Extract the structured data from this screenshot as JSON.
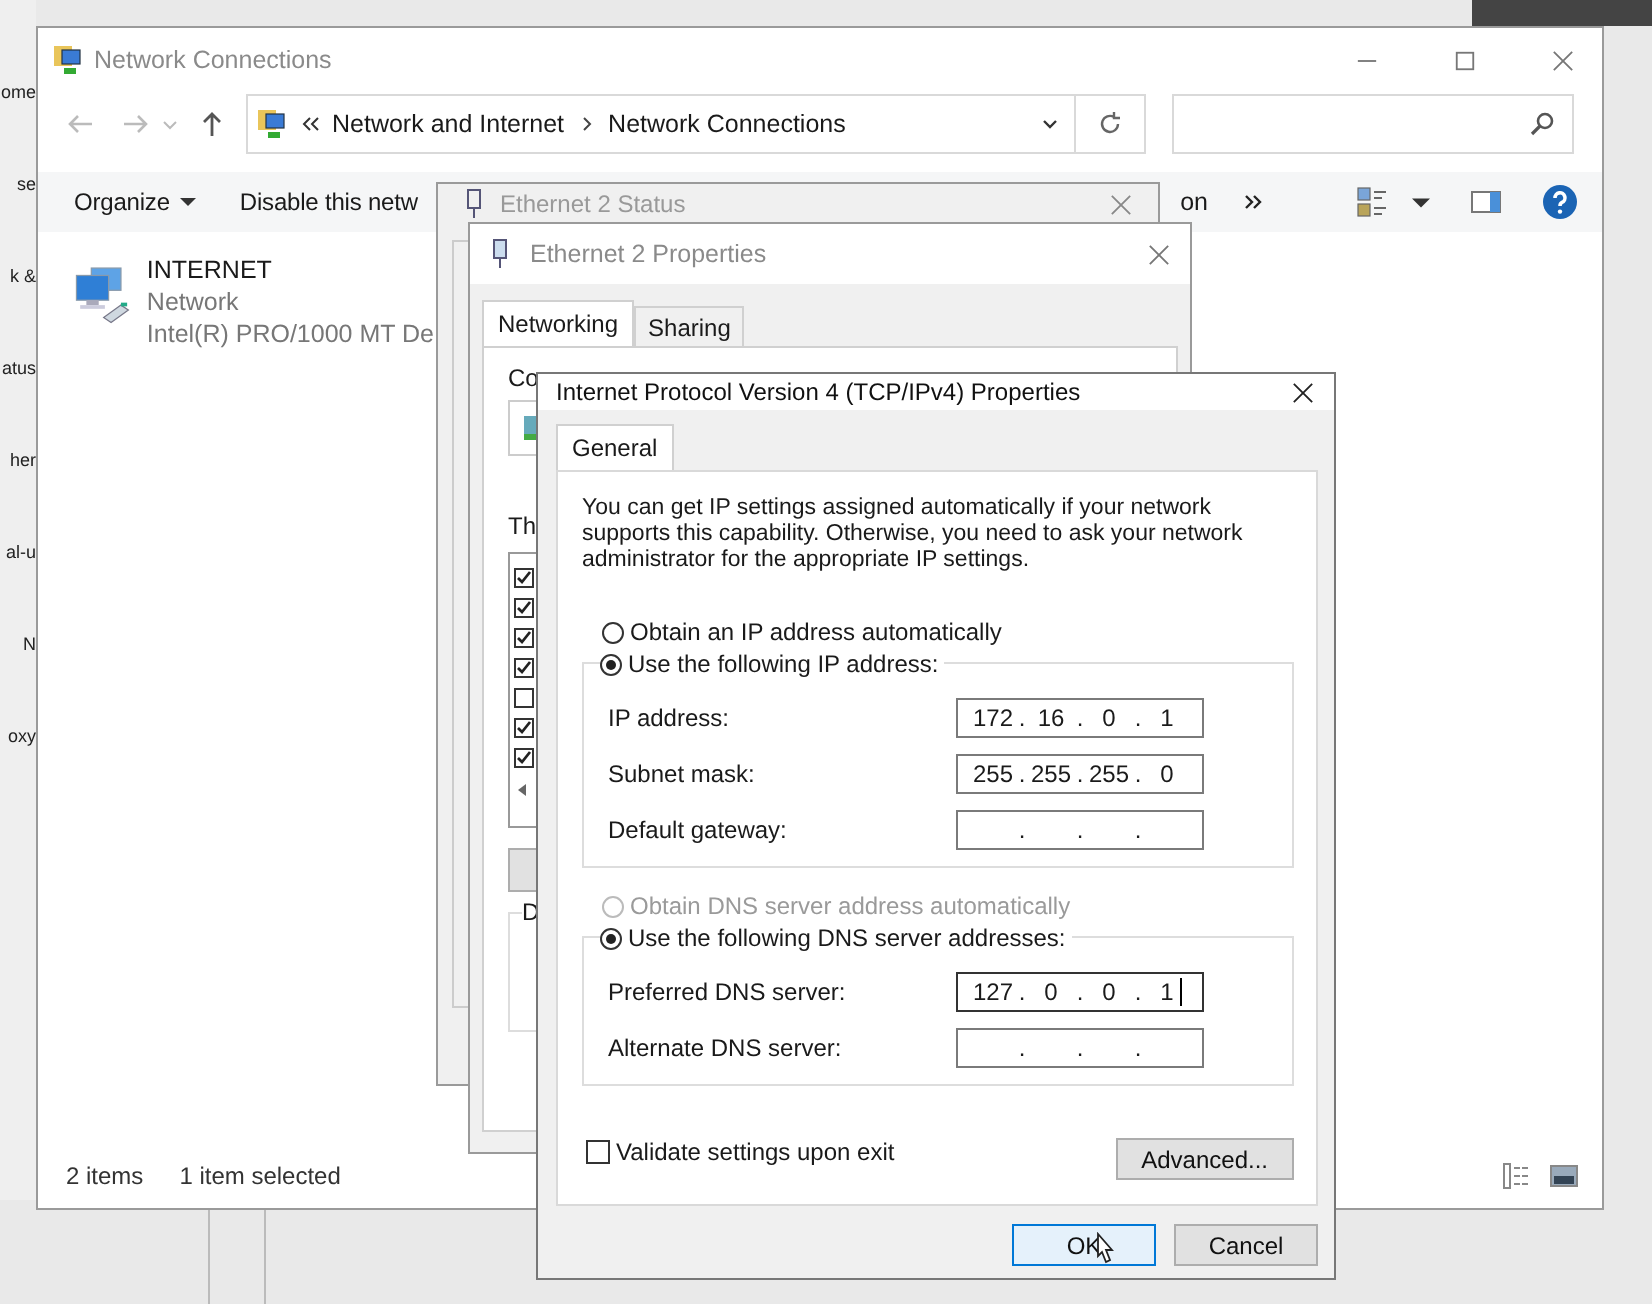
{
  "background_window": {
    "fragments": [
      "ome",
      "se",
      "k &",
      "atus",
      "her",
      "al-u",
      "N",
      "oxy"
    ]
  },
  "explorer": {
    "title": "Network Connections",
    "address": [
      "Network and Internet",
      "Network Connections"
    ],
    "toolbar": [
      {
        "label": "Organize",
        "dropdown": true
      },
      {
        "label": "Disable this netw",
        "dropdown": false
      }
    ],
    "toolbar_tail": "on",
    "items": [
      {
        "name": "INTERNET",
        "type": "Network",
        "device": "Intel(R) PRO/1000 MT De"
      }
    ],
    "status": [
      "2 items",
      "1 item selected"
    ]
  },
  "status_window": {
    "title": "Ethernet 2 Status"
  },
  "properties_window": {
    "title": "Ethernet 2 Properties",
    "tabs": [
      {
        "label": "Networking",
        "selected": true
      },
      {
        "label": "Sharing",
        "selected": false
      }
    ],
    "connect_label": "Co",
    "list_label": "Th",
    "description_label": "D",
    "components": [
      {
        "checked": true
      },
      {
        "checked": true
      },
      {
        "checked": true
      },
      {
        "checked": true
      },
      {
        "checked": false
      },
      {
        "checked": true
      },
      {
        "checked": true
      }
    ]
  },
  "ipv4_dialog": {
    "title": "Internet Protocol Version 4 (TCP/IPv4) Properties",
    "tabs": [
      {
        "label": "General",
        "selected": true
      }
    ],
    "intro": "You can get IP settings assigned automatically if your network supports this capability. Otherwise, you need to ask your network administrator for the appropriate IP settings.",
    "separator": ".",
    "ip_options": [
      {
        "label": "Obtain an IP address automatically",
        "selected": false,
        "disabled": false
      },
      {
        "label": "Use the following IP address:",
        "selected": true,
        "disabled": false
      }
    ],
    "ip_fields": [
      {
        "label": "IP address:",
        "octets": [
          "172",
          "16",
          "0",
          "1"
        ],
        "focused": false
      },
      {
        "label": "Subnet mask:",
        "octets": [
          "255",
          "255",
          "255",
          "0"
        ],
        "focused": false
      },
      {
        "label": "Default gateway:",
        "focused": false
      }
    ],
    "dns_options": [
      {
        "label": "Obtain DNS server address automatically",
        "selected": false,
        "disabled": true
      },
      {
        "label": "Use the following DNS server addresses:",
        "selected": true,
        "disabled": false
      }
    ],
    "dns_fields": [
      {
        "label": "Preferred DNS server:",
        "octets": [
          "127",
          "0",
          "0",
          "1"
        ],
        "focused": true
      },
      {
        "label": "Alternate DNS server:",
        "focused": false
      }
    ],
    "validate": {
      "label": "Validate settings upon exit",
      "checked": false
    },
    "advanced": "Advanced...",
    "buttons": [
      {
        "label": "OK",
        "default": true
      },
      {
        "label": "Cancel",
        "default": false
      }
    ]
  }
}
